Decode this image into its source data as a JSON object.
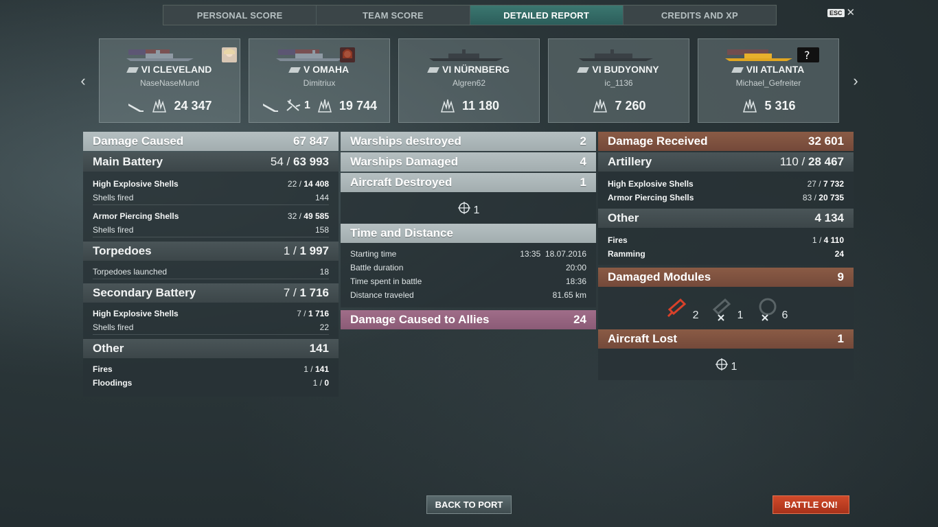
{
  "tabs": [
    "PERSONAL SCORE",
    "TEAM SCORE",
    "DETAILED REPORT",
    "CREDITS AND XP"
  ],
  "esc": {
    "key": "ESC",
    "close": "✕"
  },
  "nav": {
    "prev": "‹",
    "next": "›"
  },
  "cards": [
    {
      "ship": "VI CLEVELAND",
      "player": "NaseNaseMund",
      "icon_counts": [
        "",
        ""
      ],
      "damage": "24 347"
    },
    {
      "ship": "V OMAHA",
      "player": "Dimitriux",
      "planes": "1",
      "damage": "19 744"
    },
    {
      "ship": "VI NÜRNBERG",
      "player": "Algren62",
      "damage": "11 180"
    },
    {
      "ship": "VI BUDYONNY",
      "player": "ic_1136",
      "damage": "7 260"
    },
    {
      "ship": "VII ATLANTA",
      "player": "Michael_Gefreiter",
      "damage": "5 316"
    }
  ],
  "left": {
    "damage_caused": {
      "label": "Damage Caused",
      "value": "67 847"
    },
    "main_battery": {
      "label": "Main Battery",
      "hits": "54",
      "dmg": "63 993"
    },
    "he": {
      "label": "High Explosive Shells",
      "hits": "22",
      "dmg": "14 408",
      "fired_label": "Shells fired",
      "fired": "144"
    },
    "ap": {
      "label": "Armor Piercing Shells",
      "hits": "32",
      "dmg": "49 585",
      "fired_label": "Shells fired",
      "fired": "158"
    },
    "torpedoes": {
      "label": "Torpedoes",
      "hits": "1",
      "dmg": "1 997",
      "launched_label": "Torpedoes launched",
      "launched": "18"
    },
    "secondary": {
      "label": "Secondary Battery",
      "hits": "7",
      "dmg": "1 716",
      "he_label": "High Explosive Shells",
      "he_hits": "7",
      "he_dmg": "1 716",
      "fired_label": "Shells fired",
      "fired": "22"
    },
    "other": {
      "label": "Other",
      "value": "141",
      "fires_label": "Fires",
      "fires": "1",
      "fires_dmg": "141",
      "flood_label": "Floodings",
      "flood": "1",
      "flood_dmg": "0"
    }
  },
  "middle": {
    "destroyed": {
      "label": "Warships destroyed",
      "value": "2"
    },
    "damaged": {
      "label": "Warships Damaged",
      "value": "4"
    },
    "aircraft": {
      "label": "Aircraft Destroyed",
      "value": "1",
      "icon_count": "1"
    },
    "time": {
      "label": "Time and Distance",
      "start_label": "Starting time",
      "start": "13:35  18.07.2016",
      "dur_label": "Battle duration",
      "dur": "20:00",
      "spent_label": "Time spent in battle",
      "spent": "18:36",
      "dist_label": "Distance traveled",
      "dist": "81.65 km"
    },
    "allies": {
      "label": "Damage Caused to Allies",
      "value": "24"
    }
  },
  "right": {
    "received": {
      "label": "Damage Received",
      "value": "32 601"
    },
    "artillery": {
      "label": "Artillery",
      "hits": "110",
      "dmg": "28 467",
      "he_label": "High Explosive Shells",
      "he_hits": "27",
      "he_dmg": "7 732",
      "ap_label": "Armor Piercing Shells",
      "ap_hits": "83",
      "ap_dmg": "20 735"
    },
    "other": {
      "label": "Other",
      "value": "4 134",
      "fires_label": "Fires",
      "fires": "1",
      "fires_dmg": "4 110",
      "ram_label": "Ramming",
      "ram": "24"
    },
    "modules": {
      "label": "Damaged Modules",
      "value": "9",
      "m1": "2",
      "m2": "1",
      "m3": "6"
    },
    "aircraft_lost": {
      "label": "Aircraft Lost",
      "value": "1",
      "icon_count": "1"
    }
  },
  "buttons": {
    "back": "BACK TO PORT",
    "battle": "BATTLE ON!"
  },
  "colors": {
    "accent_tab": "#2c5e5b",
    "brown": "#7a4c3b",
    "pink": "#8b5b76",
    "battle": "#c43e22"
  }
}
